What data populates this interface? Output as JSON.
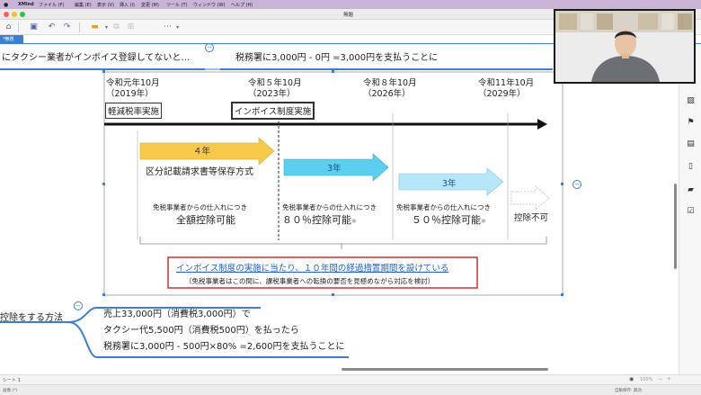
{
  "menubar": {
    "app": "XMind",
    "items": [
      "ファイル (F)",
      "編集 (E)",
      "表示 (V)",
      "挿入 (I)",
      "変更 (M)",
      "ツール (T)",
      "ウィンドウ (W)",
      "ヘルプ (H)"
    ]
  },
  "window": {
    "title": "無題"
  },
  "tab": {
    "label": "*無題"
  },
  "canvas": {
    "top_topic_left": "にタクシー業者がインボイス登録してないと…",
    "top_topic_right": "税務署に3,000円 - 0円 =3,000円を支払うことに",
    "collapse_symbol": "−",
    "timeline": {
      "dates": [
        {
          "line1": "令和元年10月",
          "line2": "（2019年）"
        },
        {
          "line1": "令和５年10月",
          "line2": "（2023年）"
        },
        {
          "line1": "令和８年10月",
          "line2": "（2026年）"
        },
        {
          "line1": "令和11年10月",
          "line2": "（2029年）"
        }
      ],
      "label_reduced_tax": "軽減税率実施",
      "label_invoice": "インボイス制度実施",
      "arrow1_years": "４年",
      "arrow1_caption": "区分記載請求書等保存方式",
      "arrow2_years": "3年",
      "arrow3_years": "3年",
      "col1_small": "免税事業者からの仕入れにつき",
      "col1_big": "全額控除可能",
      "col2_small": "免税事業者からの仕入れにつき",
      "col2_big": "８０％控除可能",
      "col3_small": "免税事業者からの仕入れにつき",
      "col3_big": "５０％控除可能",
      "asterisk": "※",
      "col4_big": "控除不可",
      "notice_title": "インボイス制度の実施に当たり、１０年間の経過措置期間を設けている",
      "notice_sub": "（免税事業者はこの間に、課税事業者への転換の要否を見極めながら対応を検討）"
    },
    "left_topic": "控除をする方法",
    "calc_line1": "売上33,000円（消費税3,000円）で",
    "calc_line2": "タクシー代5,500円（消費税500円）を払ったら",
    "calc_line3": "税務署に3,000円 - 500円×80% =2,600円を支払うことに"
  },
  "statusbar": {
    "sheet": "シート 1",
    "zoom": "100%"
  },
  "bottombar": {
    "left": "画像 (*)",
    "right": "自動保存: 無効"
  },
  "colors": {
    "accent_blue": "#3a7fd0",
    "arrow_yellow": "#f6c94a",
    "arrow_cyan": "#5ccff0",
    "arrow_lightblue": "#b6e6f8",
    "notice_red": "#d23030",
    "notice_text_blue": "#1f5fc9"
  }
}
